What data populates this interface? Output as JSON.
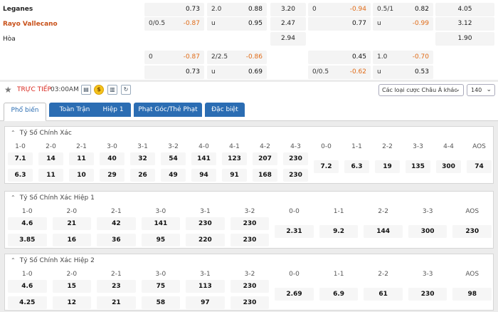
{
  "odds": {
    "teams": {
      "home": "Leganes",
      "away": "Rayo Vallecano",
      "draw": "Hòa"
    },
    "block1": [
      [
        {
          "l": "",
          "r": "0.73"
        },
        {
          "l": "2.0",
          "r": "0.88"
        },
        {
          "c": "3.20"
        },
        {
          "l": "0",
          "r": "-0.94",
          "neg": true
        },
        {
          "l": "0.5/1",
          "r": "0.82"
        },
        {
          "c": "4.05"
        }
      ],
      [
        {
          "l": "0/0.5",
          "r": "-0.87",
          "neg": true
        },
        {
          "l": "u",
          "r": "0.95"
        },
        {
          "c": "2.47"
        },
        {
          "l": "",
          "r": "0.77"
        },
        {
          "l": "u",
          "r": "-0.99",
          "neg": true
        },
        {
          "c": "3.12"
        }
      ],
      [
        null,
        null,
        {
          "c": "2.94"
        },
        null,
        null,
        {
          "c": "1.90"
        }
      ]
    ],
    "block2": [
      [
        {
          "l": "0",
          "r": "-0.87",
          "neg": true
        },
        {
          "l": "2/2.5",
          "r": "-0.86",
          "neg": true
        },
        null,
        {
          "l": "",
          "r": "0.45"
        },
        {
          "l": "1.0",
          "r": "-0.70",
          "neg": true
        },
        null
      ],
      [
        {
          "l": "",
          "r": "0.73"
        },
        {
          "l": "u",
          "r": "0.69"
        },
        null,
        {
          "l": "0/0.5",
          "r": "-0.62",
          "neg": true
        },
        {
          "l": "u",
          "r": "0.53"
        },
        null
      ]
    ]
  },
  "bar": {
    "live": "TRỰC TIẾP",
    "time": "03:00AM",
    "icons": [
      "calendar-icon",
      "coin-icon",
      "stats-icon",
      "history-icon"
    ],
    "select": "Các loại cược Châu Á khác",
    "count": "140"
  },
  "tabs": [
    "Phổ biến",
    "Toàn Trận",
    "Hiệp 1",
    "Phạt Góc/Thẻ Phạt",
    "Đặc biệt"
  ],
  "sections": [
    {
      "title": "Tỷ Số Chính Xác",
      "headers": [
        "1-0",
        "2-0",
        "2-1",
        "3-0",
        "3-1",
        "3-2",
        "4-0",
        "4-1",
        "4-2",
        "4-3",
        "0-0",
        "1-1",
        "2-2",
        "3-3",
        "4-4",
        "AOS"
      ],
      "row1": [
        "7.1",
        "14",
        "11",
        "40",
        "32",
        "54",
        "141",
        "123",
        "207",
        "230"
      ],
      "row2": [
        "6.3",
        "11",
        "10",
        "29",
        "26",
        "49",
        "94",
        "91",
        "168",
        "230"
      ],
      "mid": [
        "7.2",
        "6.3",
        "19",
        "135",
        "300",
        "74"
      ]
    },
    {
      "title": "Tỷ Số Chính Xác Hiệp 1",
      "headers": [
        "1-0",
        "2-0",
        "2-1",
        "3-0",
        "3-1",
        "3-2",
        "0-0",
        "1-1",
        "2-2",
        "3-3",
        "AOS"
      ],
      "row1": [
        "4.6",
        "21",
        "42",
        "141",
        "230",
        "230"
      ],
      "row2": [
        "3.85",
        "16",
        "36",
        "95",
        "220",
        "230"
      ],
      "mid": [
        "2.31",
        "9.2",
        "144",
        "300",
        "230"
      ]
    },
    {
      "title": "Tỷ Số Chính Xác Hiệp 2",
      "headers": [
        "1-0",
        "2-0",
        "2-1",
        "3-0",
        "3-1",
        "3-2",
        "0-0",
        "1-1",
        "2-2",
        "3-3",
        "AOS"
      ],
      "row1": [
        "4.6",
        "15",
        "23",
        "75",
        "113",
        "230"
      ],
      "row2": [
        "4.25",
        "12",
        "21",
        "58",
        "97",
        "230"
      ],
      "mid": [
        "2.69",
        "6.9",
        "61",
        "230",
        "98"
      ]
    }
  ]
}
